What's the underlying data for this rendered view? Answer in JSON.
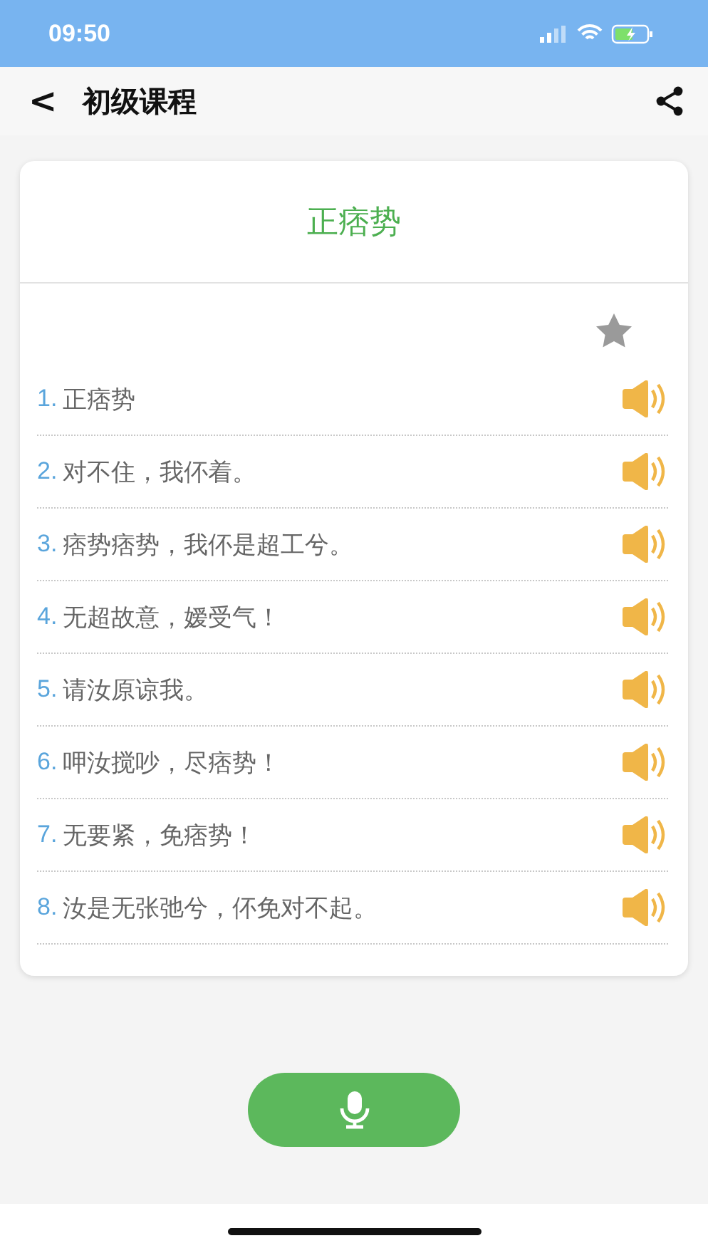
{
  "status_bar": {
    "time": "09:50"
  },
  "nav": {
    "back": "<",
    "title": "初级课程"
  },
  "card": {
    "title": "正痞势",
    "favorited": false,
    "phrases": [
      {
        "number": "1.",
        "text": "正痞势"
      },
      {
        "number": "2.",
        "text": "对不住，我伓着。"
      },
      {
        "number": "3.",
        "text": "痞势痞势，我伓是超工兮。"
      },
      {
        "number": "4.",
        "text": "无超故意，嫒受气！"
      },
      {
        "number": "5.",
        "text": "请汝原谅我。"
      },
      {
        "number": "6.",
        "text": "呷汝搅吵，尽痞势！"
      },
      {
        "number": "7.",
        "text": "无要紧，免痞势！"
      },
      {
        "number": "8.",
        "text": "汝是无张弛兮，伓免对不起。"
      }
    ]
  }
}
